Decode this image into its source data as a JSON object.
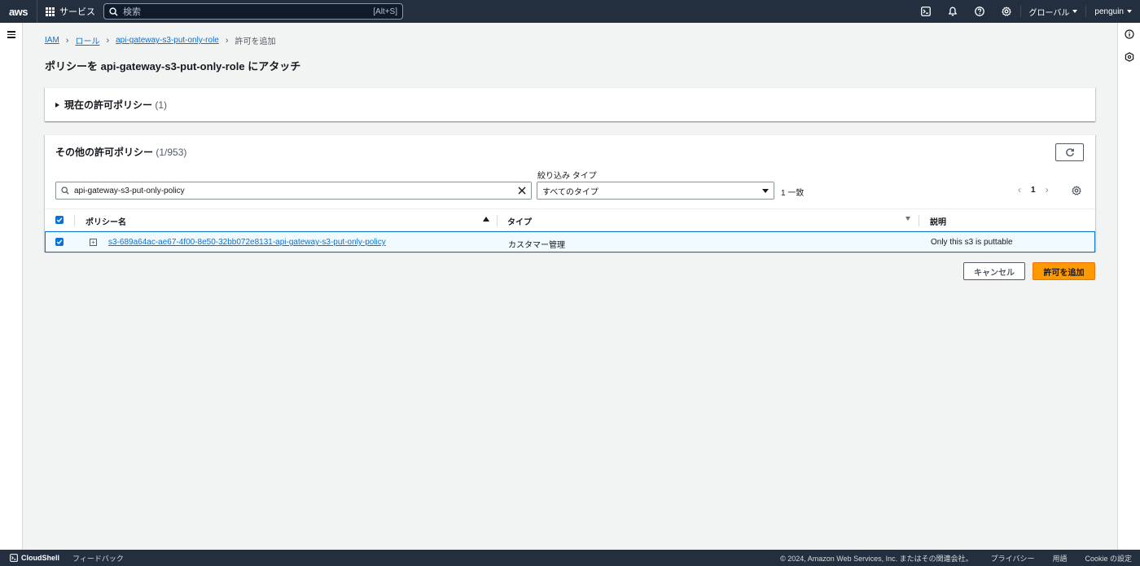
{
  "topnav": {
    "logo": "aws",
    "services_label": "サービス",
    "search_placeholder": "検索",
    "search_shortcut": "[Alt+S]",
    "region_label": "グローバル",
    "user_label": "penguin"
  },
  "breadcrumb": {
    "items": [
      "IAM",
      "ロール",
      "api-gateway-s3-put-only-role"
    ],
    "current": "許可を追加"
  },
  "page_title": "ポリシーを api-gateway-s3-put-only-role にアタッチ",
  "current_policies": {
    "title": "現在の許可ポリシー",
    "count": "(1)"
  },
  "other_policies": {
    "title": "その他の許可ポリシー",
    "count": "(1/953)",
    "filter_value": "api-gateway-s3-put-only-policy",
    "type_filter_label": "絞り込み タイプ",
    "type_filter_value": "すべてのタイプ",
    "match_text": "1 一致",
    "page_number": "1",
    "columns": [
      "ポリシー名",
      "タイプ",
      "説明"
    ],
    "rows": [
      {
        "name": "s3-689a64ac-ae67-4f00-8e50-32bb072e8131-api-gateway-s3-put-only-policy",
        "type": "カスタマー管理",
        "description": "Only this s3 is puttable",
        "selected": true
      }
    ]
  },
  "actions": {
    "cancel_label": "キャンセル",
    "submit_label": "許可を追加"
  },
  "footer": {
    "cloudshell": "CloudShell",
    "feedback": "フィードバック",
    "copyright": "© 2024, Amazon Web Services, Inc. またはその関連会社。",
    "privacy": "プライバシー",
    "terms": "用語",
    "cookie": "Cookie の設定"
  },
  "colors": {
    "nav_bg": "#232f3e",
    "link": "#0972d3",
    "primary_button": "#ff9900",
    "page_bg": "#f2f3f3"
  }
}
